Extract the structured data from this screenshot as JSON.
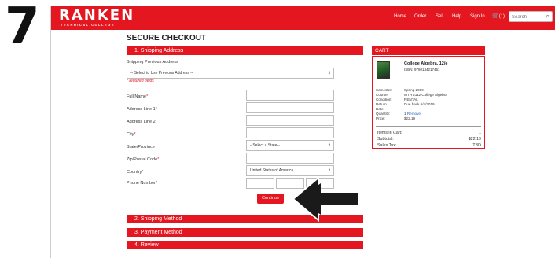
{
  "step_number": "7",
  "header": {
    "logo": "RANKEN",
    "logo_sub": "TECHNICAL COLLEGE",
    "nav": [
      "Home",
      "Order",
      "Sell",
      "Help",
      "Sign In"
    ],
    "cart_count": "(1)",
    "search_placeholder": "Search",
    "accent_color": "#e4161f"
  },
  "page_title": "SECURE CHECKOUT",
  "sections": {
    "shipping_address": "1. Shipping Address",
    "shipping_method": "2. Shipping Method",
    "payment_method": "3. Payment Method",
    "review": "4. Review"
  },
  "form": {
    "prev_address_label": "Shipping Previous Address",
    "prev_address_value": "-- Select to Use Previous Address --",
    "required_note": "* required fields",
    "full_name_label": "Full Name",
    "address1_label": "Address Line 1",
    "address2_label": "Address Line 2",
    "city_label": "City",
    "state_label": "State/Province",
    "state_value": "--Select a State--",
    "zip_label": "Zip/Postal Code",
    "country_label": "Country",
    "country_value": "United States of America",
    "phone_label": "Phone Number",
    "required_mark": "*",
    "continue_label": "Continue"
  },
  "cart": {
    "header": "CART",
    "item_title": "College Algebra, 12/e",
    "item_isbn": "ISBN: 9780134217451",
    "details": [
      {
        "key": "Semester:",
        "value": "Spring 2019"
      },
      {
        "key": "Course:",
        "value": "MTH 2112 College Algebra"
      },
      {
        "key": "Condition:",
        "value": "RENTAL"
      },
      {
        "key": "Return",
        "value": "Due back 6/4/2019"
      },
      {
        "key": "Date:",
        "value": ""
      },
      {
        "key": "Quantity:",
        "value": "1"
      },
      {
        "key": "Price:",
        "value": "$22.19"
      }
    ],
    "remove_label": "Remove",
    "summary": [
      {
        "key": "Items in Cart:",
        "value": "1"
      },
      {
        "key": "Subtotal:",
        "value": "$22.19"
      },
      {
        "key": "Sales Tax:",
        "value": "TBD"
      }
    ]
  }
}
